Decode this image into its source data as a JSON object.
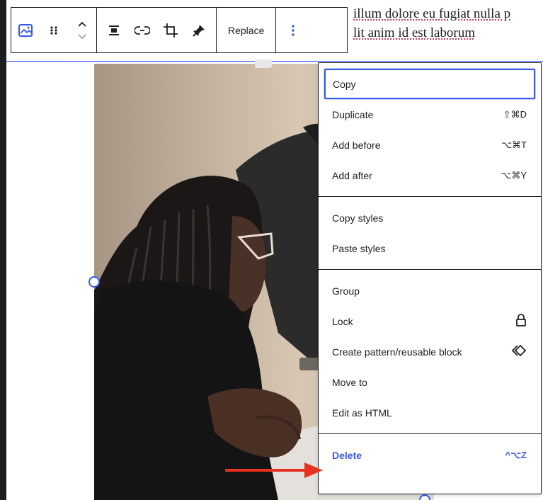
{
  "paragraph": {
    "line1": "illum dolore eu fugiat nulla p",
    "line2": "lit anim id est laborum"
  },
  "toolbar": {
    "replace_label": "Replace",
    "icons": [
      "image-icon",
      "drag-handle-icon",
      "move-up-down-icon",
      "align-icon",
      "link-icon",
      "crop-icon",
      "pin-icon",
      "more-options-icon"
    ]
  },
  "menu": {
    "sections": [
      {
        "items": [
          {
            "label": "Copy",
            "shortcut": "",
            "focused": true
          },
          {
            "label": "Duplicate",
            "shortcut": "⇧⌘D"
          },
          {
            "label": "Add before",
            "shortcut": "⌥⌘T"
          },
          {
            "label": "Add after",
            "shortcut": "⌥⌘Y"
          }
        ]
      },
      {
        "items": [
          {
            "label": "Copy styles",
            "shortcut": ""
          },
          {
            "label": "Paste styles",
            "shortcut": ""
          }
        ]
      },
      {
        "items": [
          {
            "label": "Group",
            "shortcut": ""
          },
          {
            "label": "Lock",
            "icon": "lock-icon"
          },
          {
            "label": "Create pattern/reusable block",
            "icon": "reusable-block-icon"
          },
          {
            "label": "Move to",
            "shortcut": ""
          },
          {
            "label": "Edit as HTML",
            "shortcut": ""
          }
        ]
      },
      {
        "items": [
          {
            "label": "Delete",
            "shortcut": "^⌥Z",
            "danger": true
          }
        ]
      }
    ]
  },
  "colors": {
    "accent": "#3858e9",
    "text": "#1e1e1e",
    "arrow": "#e8321f"
  }
}
